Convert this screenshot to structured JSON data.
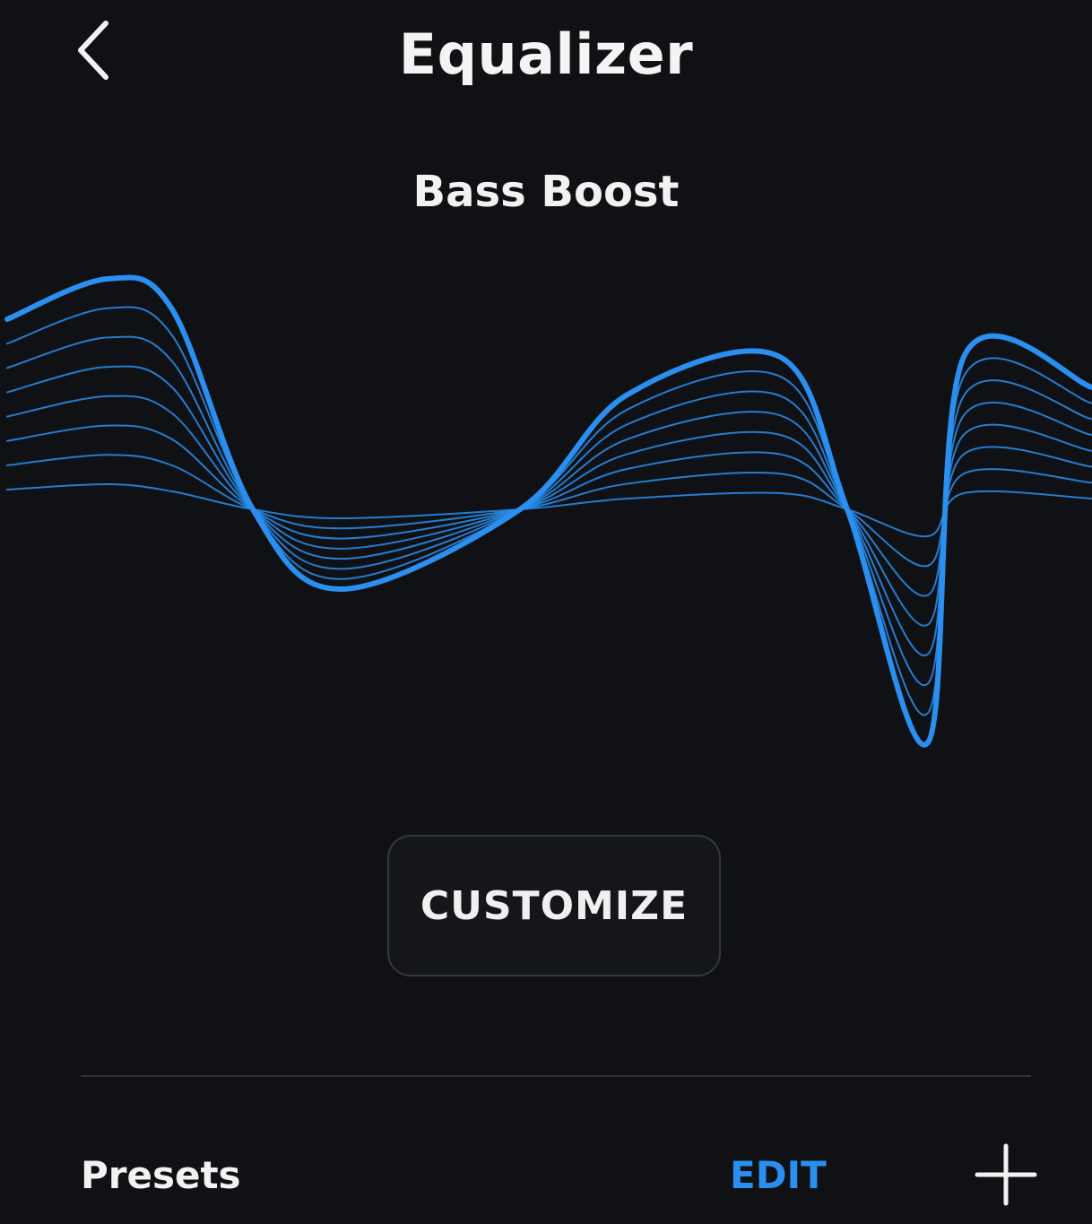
{
  "header": {
    "title": "Equalizer",
    "back_icon": "chevron-left-icon"
  },
  "preset": {
    "name": "Bass Boost"
  },
  "eq_graph": {
    "accent_color": "#2a8ff0",
    "line_count": 8
  },
  "customize": {
    "label": "CUSTOMIZE"
  },
  "presets_section": {
    "label": "Presets",
    "edit_label": "EDIT",
    "add_icon": "plus-icon"
  },
  "colors": {
    "background": "#0f1114",
    "accent": "#2a8ff0",
    "text": "#f2f2f2",
    "button_border": "#34373d"
  }
}
